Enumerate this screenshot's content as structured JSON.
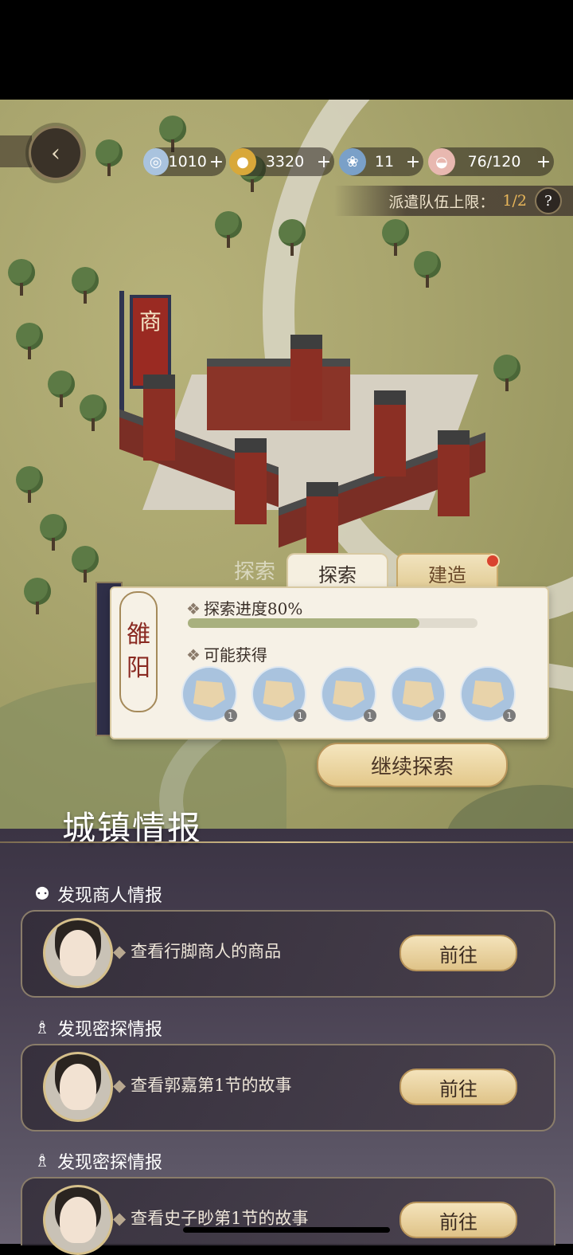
{
  "resources": [
    {
      "icon": "jade-orb-icon",
      "value": "1010",
      "color": "#a9c3de"
    },
    {
      "icon": "gold-coin-icon",
      "value": "3320",
      "color": "#d8a83a"
    },
    {
      "icon": "scroll-icon",
      "value": "11",
      "color": "#7aa0c8"
    },
    {
      "icon": "food-bowl-icon",
      "value": "76/120",
      "color": "#e8b8b0"
    }
  ],
  "dispatch": {
    "label": "派遣队伍上限：",
    "count": "1/2",
    "help": "?"
  },
  "map": {
    "banner": "商"
  },
  "tabs": {
    "ghost": "探索",
    "active": "探索",
    "inactive": "建造"
  },
  "explore": {
    "city": [
      "雒",
      "阳"
    ],
    "progress_label": "探索进度80%",
    "progress": 0.8,
    "rewards_label": "可能获得",
    "rewards": [
      {
        "icon": "map-fragment-icon",
        "count": "1"
      },
      {
        "icon": "map-fragment-icon",
        "count": "1"
      },
      {
        "icon": "map-fragment-icon",
        "count": "1"
      },
      {
        "icon": "map-fragment-icon",
        "count": "1"
      },
      {
        "icon": "map-fragment-icon",
        "count": "1"
      }
    ],
    "continue_label": "继续探索"
  },
  "info": {
    "title": "城镇情报",
    "cards": [
      {
        "header": "发现商人情报",
        "text": "查看行脚商人的商品",
        "button": "前往"
      },
      {
        "header": "发现密探情报",
        "text": "查看郭嘉第1节的故事",
        "button": "前往"
      },
      {
        "header": "发现密探情报",
        "text": "查看史子眇第1节的故事",
        "button": "前往"
      }
    ]
  }
}
